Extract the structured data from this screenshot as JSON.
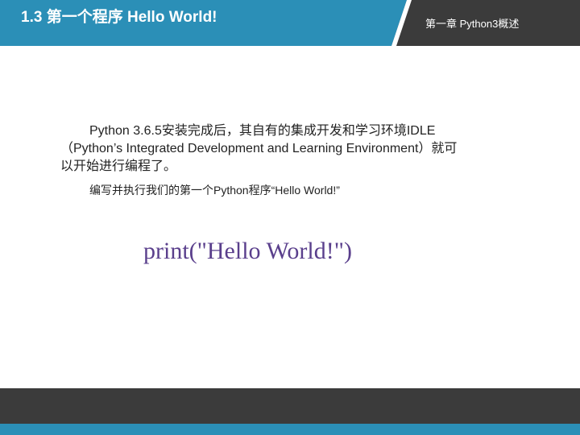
{
  "header": {
    "title": "1.3 第一个程序 Hello World!",
    "chapter": "第一章 Python3概述",
    "colors": {
      "bar": "#3b3b3b",
      "accent": "#2b8fb7"
    }
  },
  "content": {
    "intro": "Python 3.6.5安装完成后，其自有的集成开发和学习环境IDLE（Python’s Integrated Development and Learning Environment）就可以开始进行编程了。",
    "instruction": "编写并执行我们的第一个Python程序“Hello World!”",
    "code": "print(\"Hello World!\")"
  },
  "footer": {
    "colors": {
      "bar": "#3b3b3b",
      "accent": "#2b8fb7"
    }
  }
}
